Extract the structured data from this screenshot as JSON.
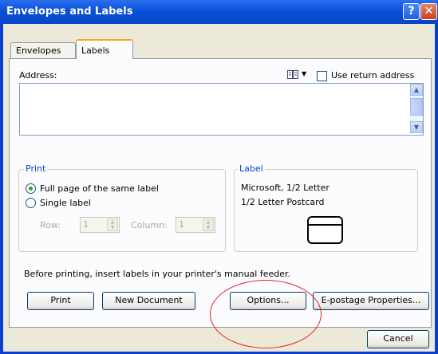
{
  "window": {
    "title": "Envelopes and Labels",
    "help_glyph": "?",
    "close_glyph": "✕"
  },
  "tabs": [
    {
      "label": "Envelopes"
    },
    {
      "label": "Labels"
    }
  ],
  "address": {
    "label": "Address:",
    "value": "",
    "use_return_label": "Use return address",
    "use_return_checked": false
  },
  "print_group": {
    "title": "Print",
    "options": [
      {
        "label": "Full page of the same label",
        "selected": true
      },
      {
        "label": "Single label",
        "selected": false
      }
    ],
    "row_label": "Row:",
    "row_value": "1",
    "column_label": "Column:",
    "column_value": "1"
  },
  "label_group": {
    "title": "Label",
    "line1": "Microsoft, 1/2 Letter",
    "line2": "1/2 Letter Postcard"
  },
  "instruction": "Before printing, insert labels in your printer's manual feeder.",
  "buttons": {
    "print": "Print",
    "new_document": "New Document",
    "options": "Options...",
    "epostage": "E-postage Properties...",
    "cancel": "Cancel"
  },
  "colors": {
    "title_bar": "#0a4fd8",
    "dialog_bg": "#ece9d8",
    "group_title": "#0046d5",
    "annotation": "#e02020"
  }
}
